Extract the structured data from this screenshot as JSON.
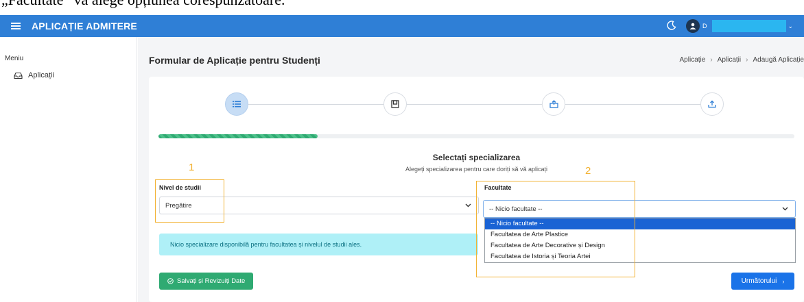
{
  "document": {
    "caption": "„Facultate” va alege opțiunea corespunzătoare."
  },
  "header": {
    "app_title": "APLICAȚIE ADMITERE",
    "user_initial": "D"
  },
  "sidebar": {
    "menu_label": "Meniu",
    "items": [
      {
        "label": "Aplicații",
        "icon": "inbox-icon"
      }
    ]
  },
  "page": {
    "title": "Formular de Aplicație pentru Studenți",
    "breadcrumb": [
      "Aplicație",
      "Aplicații",
      "Adaugă Aplicație"
    ]
  },
  "wizard": {
    "steps": [
      {
        "icon": "list-icon",
        "active": true
      },
      {
        "icon": "form-icon",
        "active": false
      },
      {
        "icon": "upload-box-icon",
        "active": false
      },
      {
        "icon": "upload-icon",
        "active": false
      }
    ],
    "progress_fraction": 0.25
  },
  "section": {
    "title": "Selectați specializarea",
    "subtitle": "Alegeți specializarea pentru care doriți să vă aplicați"
  },
  "form": {
    "nivel_label": "Nivel de studii",
    "nivel_value": "Pregătire",
    "facultate_label": "Facultate",
    "facultate_value": "-- Nicio facultate --",
    "facultate_options": [
      "-- Nicio facultate --",
      "Facultatea de Arte Plastice",
      "Facultatea de Arte Decorative și Design",
      "Facultatea de Istoria și Teoria Artei"
    ],
    "selected_option_index": 0
  },
  "alert": {
    "text": "Nicio specializare disponibilă pentru facultatea și nivelul de studii ales."
  },
  "buttons": {
    "save_label": "Salvați și Revizuiți Date",
    "next_label": "Următorului"
  },
  "annotations": {
    "label_1": "1",
    "label_2": "2",
    "color": "#f2b233"
  },
  "colors": {
    "header": "#2f7fd6",
    "progress": "#2faa72",
    "primary_button": "#1a73e8",
    "alert_bg": "#aff0f7"
  }
}
